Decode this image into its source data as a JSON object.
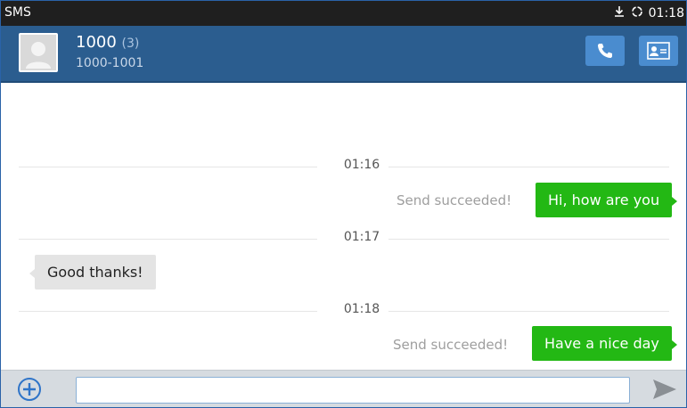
{
  "status_bar": {
    "app_name": "SMS",
    "time": "01:18"
  },
  "header": {
    "contact_name": "1000",
    "message_count": "(3)",
    "contact_number": "1000-1001"
  },
  "messages": [
    {
      "type": "timestamp",
      "text": "01:16"
    },
    {
      "type": "outgoing",
      "text": "Hi, how are you",
      "status": "Send succeeded!"
    },
    {
      "type": "timestamp",
      "text": "01:17"
    },
    {
      "type": "incoming",
      "text": "Good thanks!"
    },
    {
      "type": "timestamp",
      "text": "01:18"
    },
    {
      "type": "outgoing",
      "text": "Have a nice day",
      "status": "Send succeeded!"
    }
  ],
  "composer": {
    "input_value": "",
    "placeholder": ""
  },
  "icons": {
    "download": "download-icon",
    "sync": "sync-icon",
    "avatar": "person-avatar-icon",
    "call": "phone-icon",
    "contact": "contact-card-icon",
    "add": "plus-circle-icon",
    "send": "send-arrow-icon"
  },
  "colors": {
    "status_bar": "#1f1f1f",
    "header": "#2b5d8f",
    "header_button": "#4a8ccf",
    "outgoing_bubble": "#23b814",
    "incoming_bubble": "#e4e4e4",
    "composer": "#d6dbe0"
  }
}
